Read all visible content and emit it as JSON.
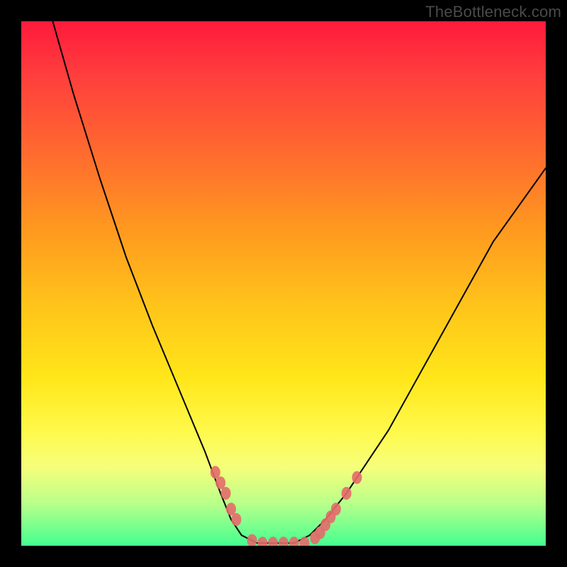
{
  "watermark": "TheBottleneck.com",
  "chart_data": {
    "type": "line",
    "title": "",
    "xlabel": "",
    "ylabel": "",
    "xlim": [
      0,
      100
    ],
    "ylim": [
      0,
      100
    ],
    "series": [
      {
        "name": "bottleneck-curve",
        "x": [
          6,
          10,
          15,
          20,
          25,
          30,
          35,
          38,
          40,
          42,
          45,
          48,
          50,
          52,
          55,
          58,
          62,
          70,
          80,
          90,
          100
        ],
        "y": [
          100,
          86,
          70,
          55,
          42,
          30,
          18,
          10,
          5,
          2,
          0.5,
          0.5,
          0.5,
          0.5,
          2,
          5,
          10,
          22,
          40,
          58,
          72
        ]
      }
    ],
    "markers": {
      "name": "highlight-dots",
      "x": [
        37,
        38,
        39,
        40,
        41,
        44,
        46,
        48,
        50,
        52,
        54,
        56,
        57,
        58,
        59,
        60,
        62,
        64
      ],
      "y": [
        14,
        12,
        10,
        7,
        5,
        1,
        0.5,
        0.5,
        0.5,
        0.5,
        0.5,
        1.5,
        2.5,
        4,
        5.5,
        7,
        10,
        13
      ]
    },
    "gradient_stops": [
      {
        "pos": 0,
        "color": "#ff1a3c"
      },
      {
        "pos": 25,
        "color": "#ff6a2f"
      },
      {
        "pos": 55,
        "color": "#ffc61a"
      },
      {
        "pos": 78,
        "color": "#fff94a"
      },
      {
        "pos": 100,
        "color": "#44ff90"
      }
    ]
  }
}
